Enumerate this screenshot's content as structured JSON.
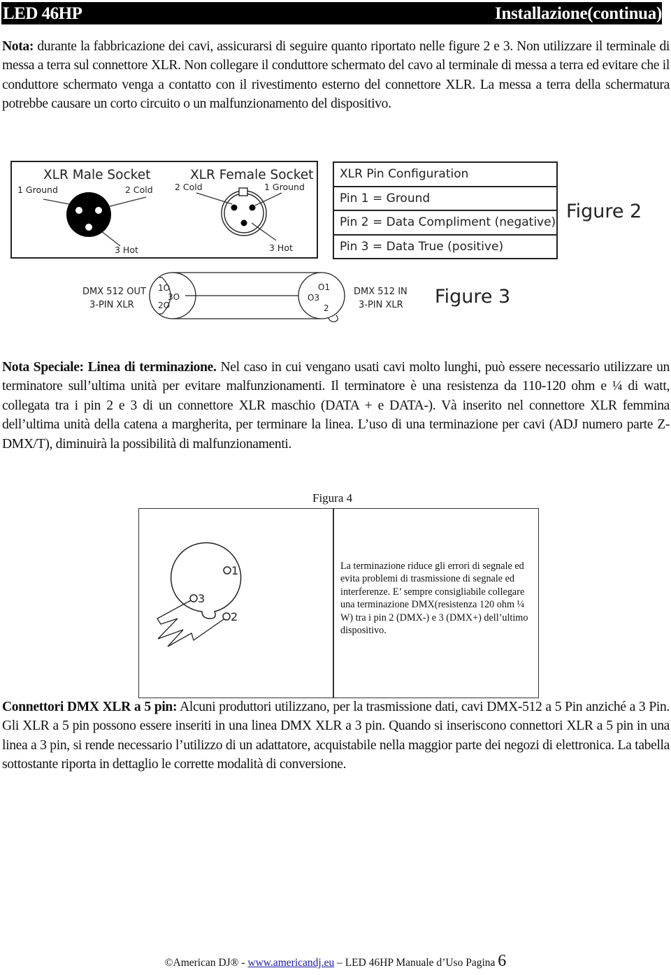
{
  "header": {
    "product": "LED 46HP",
    "section": "Installazione(continua)"
  },
  "note": {
    "label": "Nota:",
    "text": " durante la fabbricazione dei cavi, assicurarsi di seguire quanto riportato nelle figure 2 e 3. Non utilizzare il terminale di messa a terra sul connettore XLR. Non collegare il conduttore schermato del cavo al terminale di messa a terra ed evitare che il conduttore schermato venga a contatto con il rivestimento esterno del connettore XLR. La messa a terra della schermatura potrebbe causare un corto circuito o un malfunzionamento del dispositivo."
  },
  "figure2": {
    "male_title": "XLR Male Socket",
    "female_title": "XLR Female Socket",
    "male_labels": {
      "pin1": "1 Ground",
      "pin2": "2 Cold",
      "pin3": "3 Hot"
    },
    "female_labels": {
      "pin2": "2 Cold",
      "pin1": "1 Ground",
      "pin3": "3 Hot"
    },
    "table_rows": [
      "XLR Pin Configuration",
      "Pin 1 = Ground",
      "Pin 2 = Data Compliment (negative)",
      "Pin 3 = Data True (positive)"
    ],
    "label": "Figure 2"
  },
  "figure3": {
    "out_label_line1": "DMX 512 OUT",
    "out_label_line2": "3-PIN XLR",
    "in_label_line1": "DMX 512 IN",
    "in_label_line2": "3-PIN XLR",
    "out_pins": {
      "p1": "1O",
      "p3": "3O",
      "p2": "2O"
    },
    "in_pins": {
      "p1": "O1",
      "p3": "O3",
      "p2": "2"
    },
    "label": "Figure 3"
  },
  "special_note": {
    "label": "Nota Speciale: Linea di terminazione.",
    "text": " Nel caso in cui vengano usati cavi molto lunghi, può essere necessario utilizzare un terminatore sull’ultima unità per evitare malfunzionamenti. Il terminatore è una resistenza da 110-120 ohm e ¼ di watt, collegata tra i pin 2 e 3 di un connettore XLR maschio (DATA + e DATA-). Và inserito nel connettore XLR femmina dell’ultima unità della catena a margherita, per terminare la linea. L’uso di una terminazione per cavi (ADJ numero parte Z-DMX/T), diminuirà la possibilità di malfunzionamenti."
  },
  "figure4": {
    "caption": "Figura 4",
    "pins": {
      "p1": "1",
      "p3": "3",
      "p2": "2"
    },
    "description": "La terminazione riduce gli errori di segnale ed evita problemi di trasmissione di segnale ed interferenze. E’ sempre consigliabile collegare una terminazione DMX(resistenza 120 ohm ¼ W) tra i pin 2 (DMX-) e 3 (DMX+) dell’ultimo dispositivo."
  },
  "five_pin": {
    "label": "Connettori DMX XLR  a 5 pin:",
    "text": " Alcuni produttori utilizzano, per la trasmissione dati, cavi DMX-512 a 5 Pin anziché a 3 Pin. Gli XLR a 5 pin possono essere inseriti in una linea DMX XLR a 3 pin. Quando si inseriscono connettori XLR a 5 pin in una linea a 3 pin, si rende necessario l’utilizzo di un adattatore, acquistabile nella maggior parte dei negozi di elettronica. La tabella sottostante riporta in dettaglio le corrette modalità di conversione."
  },
  "footer": {
    "copyright": "©American DJ® - ",
    "link": "www.americandj.eu",
    "rest": " – LED 46HP Manuale d’Uso Pagina ",
    "page_number": "6"
  }
}
